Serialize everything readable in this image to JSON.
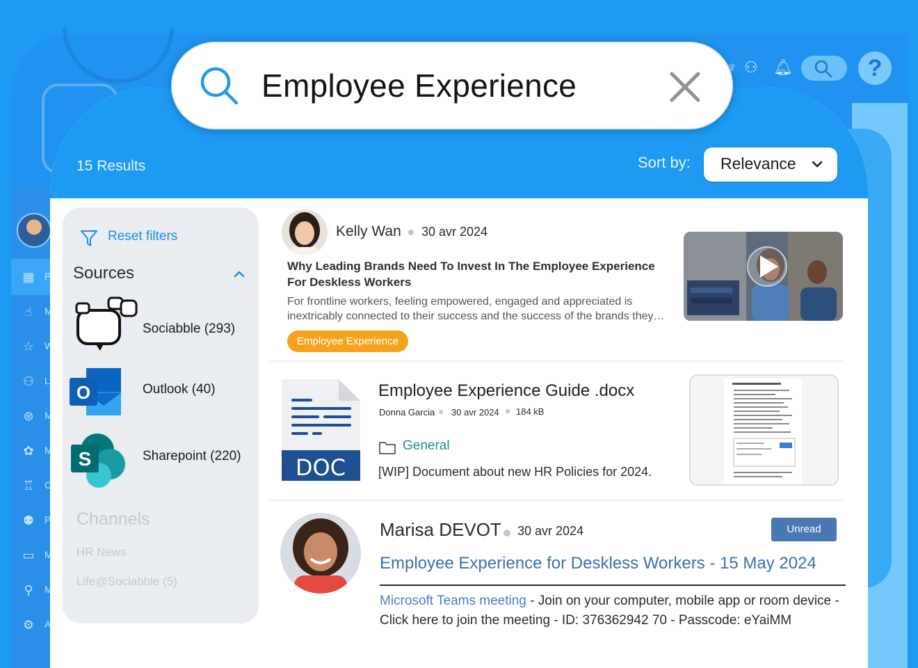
{
  "search": {
    "query": "Employee Experience"
  },
  "header": {
    "results_count": "15 Results",
    "sort_label": "Sort by:",
    "sort_value": "Relevance"
  },
  "filters": {
    "reset_label": "Reset filters",
    "sources_title": "Sources",
    "sources": [
      {
        "label": "Sociabble (293)",
        "icon": "sociabble-icon"
      },
      {
        "label": "Outlook (40)",
        "icon": "outlook-icon"
      },
      {
        "label": "Sharepoint (220)",
        "icon": "sharepoint-icon"
      }
    ],
    "channels_title": "Channels",
    "channels": [
      "HR News",
      "Life@Sociabble (5)"
    ]
  },
  "sidebar": {
    "letters": [
      "P",
      "M",
      "W",
      "L",
      "M",
      "M",
      "C",
      "P",
      "M",
      "M",
      "A"
    ]
  },
  "results": [
    {
      "author": "Kelly Wan",
      "date": "30 avr 2024",
      "title": "Why Leading Brands Need To Invest In The Employee Experience For Deskless Workers",
      "description": "For frontline workers, feeling empowered, engaged and appreciated is inextricably connected to their success and the success of the brands they…",
      "tag": "Employee Experience"
    },
    {
      "title": "Employee Experience Guide .docx",
      "author": "Donna Garcia",
      "date": "30 avr 2024",
      "size": "184 kB",
      "folder": "General",
      "description": "[WIP] Document about new HR Policies for 2024.",
      "doc_label": "DOC"
    },
    {
      "author": "Marisa DEVOT",
      "date": "30 avr 2024",
      "badge": "Unread",
      "title": "Employee Experience for Deskless Workers - 15 May 2024",
      "link_text": "Microsoft Teams meeting",
      "description": " - Join on your computer, mobile app or room device - Click here to join the meeting - ID: 376362942 70 - Passcode: eYaiMM"
    }
  ],
  "colors": {
    "brand_blue": "#1e9af3",
    "tag_orange": "#f5a31e",
    "unread_badge": "#4a78b4",
    "link_blue": "#3d6fae"
  }
}
